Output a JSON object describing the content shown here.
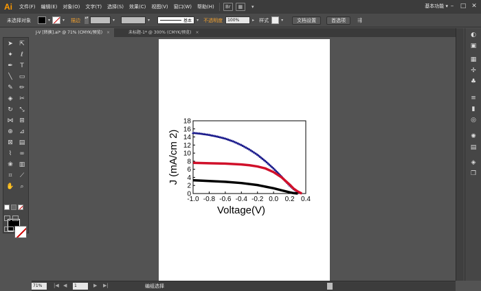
{
  "app": {
    "logo": "Ai"
  },
  "menu": [
    "文件(F)",
    "编辑(E)",
    "对象(O)",
    "文字(T)",
    "选择(S)",
    "效果(C)",
    "视图(V)",
    "窗口(W)",
    "帮助(H)"
  ],
  "workspace": {
    "label": "基本功能",
    "arrow": "▾"
  },
  "window_controls": {
    "minimize": "–",
    "restore": "□",
    "close": "✕"
  },
  "control_bar": {
    "selection_label": "未选择对象",
    "stroke_label": "描边",
    "stroke_style": "基本",
    "opacity_label": "不透明度",
    "opacity_value": "100%",
    "style_label": "样式",
    "doc_setup_button": "文档设置",
    "preferences_button": "首选项"
  },
  "tabs": [
    {
      "label": "J-V [转换].ai* @ 71% (CMYK/预览)",
      "close": "×",
      "active": true
    },
    {
      "label": "未标题-1* @ 300% (CMYK/预览)",
      "close": "×",
      "active": false
    }
  ],
  "status_bar": {
    "zoom": "71%",
    "page": "1",
    "status_text": "编组选择",
    "nav_first": "|◀",
    "nav_prev": "◀",
    "nav_next": "▶",
    "nav_last": "▶|"
  },
  "colors": {
    "accent_orange": "#ff9a00",
    "series_blue": "#1c1c8c",
    "series_red": "#d0102a",
    "series_black": "#000000"
  },
  "chart_data": {
    "type": "scatter",
    "xlabel": "Voltage(V)",
    "ylabel": "J (mA/cm 2)",
    "xlim": [
      -1.0,
      0.4
    ],
    "ylim": [
      0,
      18
    ],
    "x_ticks": [
      "-1.0",
      "-0.8",
      "-0.6",
      "-0.4",
      "-0.2",
      "0.0",
      "0.2",
      "0.4"
    ],
    "y_ticks": [
      "0",
      "2",
      "4",
      "6",
      "8",
      "10",
      "12",
      "14",
      "16",
      "18"
    ],
    "grid": false,
    "series": [
      {
        "color": "#1c1c8c",
        "marker": "triangle",
        "x": [
          -1.0,
          -0.9,
          -0.8,
          -0.7,
          -0.6,
          -0.5,
          -0.4,
          -0.3,
          -0.2,
          -0.1,
          0.0,
          0.1,
          0.2,
          0.25,
          0.3,
          0.35
        ],
        "y": [
          15.0,
          14.8,
          14.5,
          14.1,
          13.6,
          12.9,
          12.0,
          10.9,
          9.6,
          8.0,
          6.2,
          4.2,
          2.0,
          1.1,
          0.4,
          0.0
        ]
      },
      {
        "color": "#d0102a",
        "marker": "line",
        "x": [
          -1.0,
          -0.8,
          -0.6,
          -0.4,
          -0.3,
          -0.2,
          -0.1,
          0.0,
          0.1,
          0.2,
          0.25,
          0.3,
          0.35
        ],
        "y": [
          7.6,
          7.5,
          7.4,
          7.2,
          7.0,
          6.7,
          6.2,
          5.3,
          4.0,
          2.2,
          1.2,
          0.5,
          0.0
        ]
      },
      {
        "color": "#000000",
        "marker": "line",
        "x": [
          -1.0,
          -0.8,
          -0.6,
          -0.4,
          -0.2,
          -0.1,
          0.0,
          0.1,
          0.2,
          0.25,
          0.3
        ],
        "y": [
          3.3,
          3.1,
          2.9,
          2.6,
          2.1,
          1.7,
          1.3,
          0.8,
          0.3,
          0.1,
          0.0
        ]
      }
    ]
  }
}
